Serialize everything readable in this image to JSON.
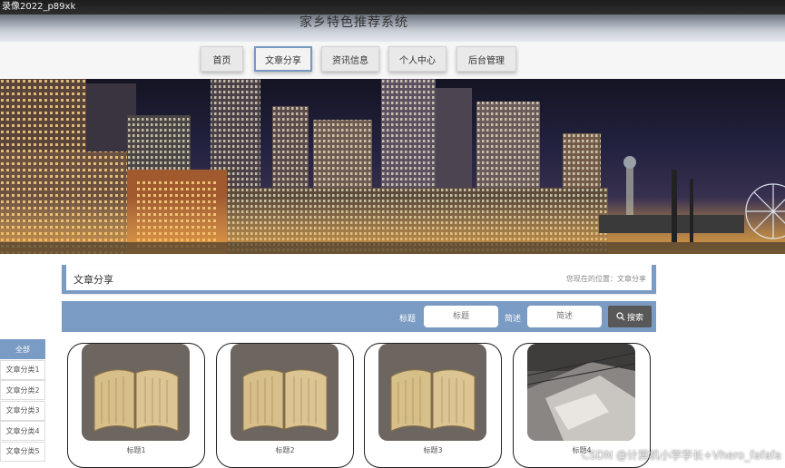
{
  "window": {
    "title": "录像2022_p89xk"
  },
  "header": {
    "site_title": "家乡特色推荐系统"
  },
  "nav": {
    "items": [
      {
        "label": "首页"
      },
      {
        "label": "文章分享"
      },
      {
        "label": "资讯信息"
      },
      {
        "label": "个人中心"
      },
      {
        "label": "后台管理"
      }
    ],
    "active_index": 1
  },
  "section": {
    "title": "文章分享",
    "breadcrumb": "您现在的位置：文章分享"
  },
  "search": {
    "label_keyword": "标题",
    "placeholder_keyword": "标题",
    "label_intro": "简述",
    "placeholder_intro": "简述",
    "button_label": "搜索"
  },
  "categories": [
    {
      "label": "全部"
    },
    {
      "label": "文章分类1"
    },
    {
      "label": "文章分类2"
    },
    {
      "label": "文章分类3"
    },
    {
      "label": "文章分类4"
    },
    {
      "label": "文章分类5"
    }
  ],
  "cards": [
    {
      "caption": "标题1"
    },
    {
      "caption": "标题2"
    },
    {
      "caption": "标题3"
    },
    {
      "caption": "标题4"
    }
  ],
  "watermark": "CSDN @计算机小学学长+Vhero_fafafa",
  "colors": {
    "accent": "#7a9bc4",
    "button_dark": "#585858"
  },
  "icons": {
    "search": "search-icon"
  }
}
